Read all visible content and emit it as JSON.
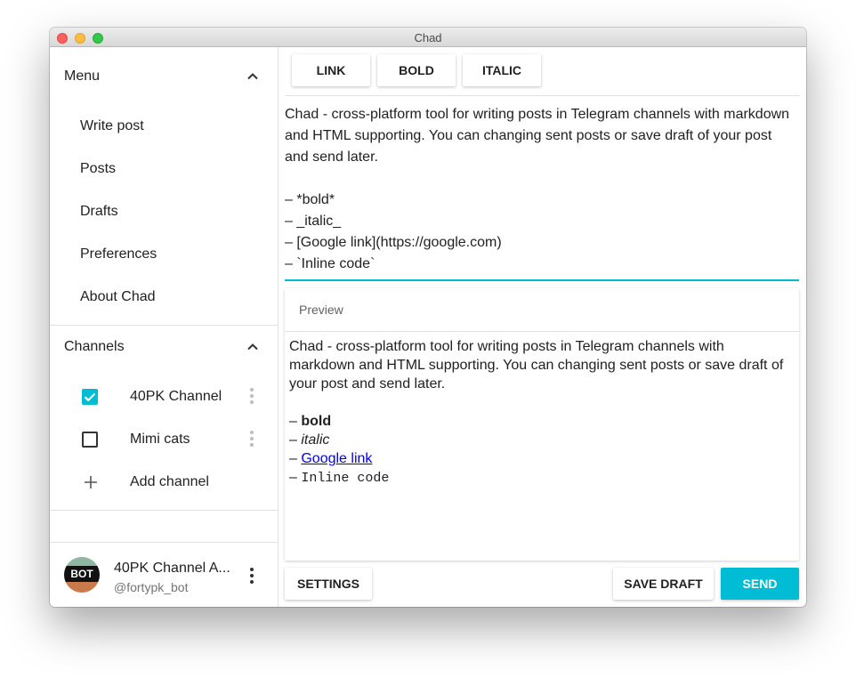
{
  "window": {
    "title": "Chad"
  },
  "sidebar": {
    "menu_label": "Menu",
    "menu_items": [
      "Write post",
      "Posts",
      "Drafts",
      "Preferences",
      "About Chad"
    ],
    "channels_label": "Channels",
    "channels": [
      {
        "name": "40PK Channel",
        "checked": true
      },
      {
        "name": "Mimi cats",
        "checked": false
      }
    ],
    "add_channel_label": "Add channel",
    "account": {
      "name": "40PK Channel A...",
      "handle": "@fortypk_bot",
      "avatar_text": "BOT"
    }
  },
  "toolbar": {
    "link_label": "LINK",
    "bold_label": "BOLD",
    "italic_label": "ITALIC"
  },
  "editor": {
    "value": "Chad - cross-platform tool for writing posts in Telegram channels with markdown and HTML supporting. You can changing sent posts or save draft of your post and send later.\n\n– *bold*\n– _italic_\n– [Google link](https://google.com)\n– `Inline code`"
  },
  "preview": {
    "heading": "Preview",
    "intro": "Chad - cross-platform tool for writing posts in Telegram channels with markdown and HTML supporting. You can changing sent posts or save draft of your post and send later.",
    "dash": "–",
    "bold_text": "bold",
    "italic_text": "italic",
    "link_text": "Google link",
    "code_text": "Inline code"
  },
  "actions": {
    "settings_label": "SETTINGS",
    "save_draft_label": "SAVE DRAFT",
    "send_label": "SEND"
  },
  "colors": {
    "accent": "#00bcd4",
    "link": "#0000ee"
  }
}
